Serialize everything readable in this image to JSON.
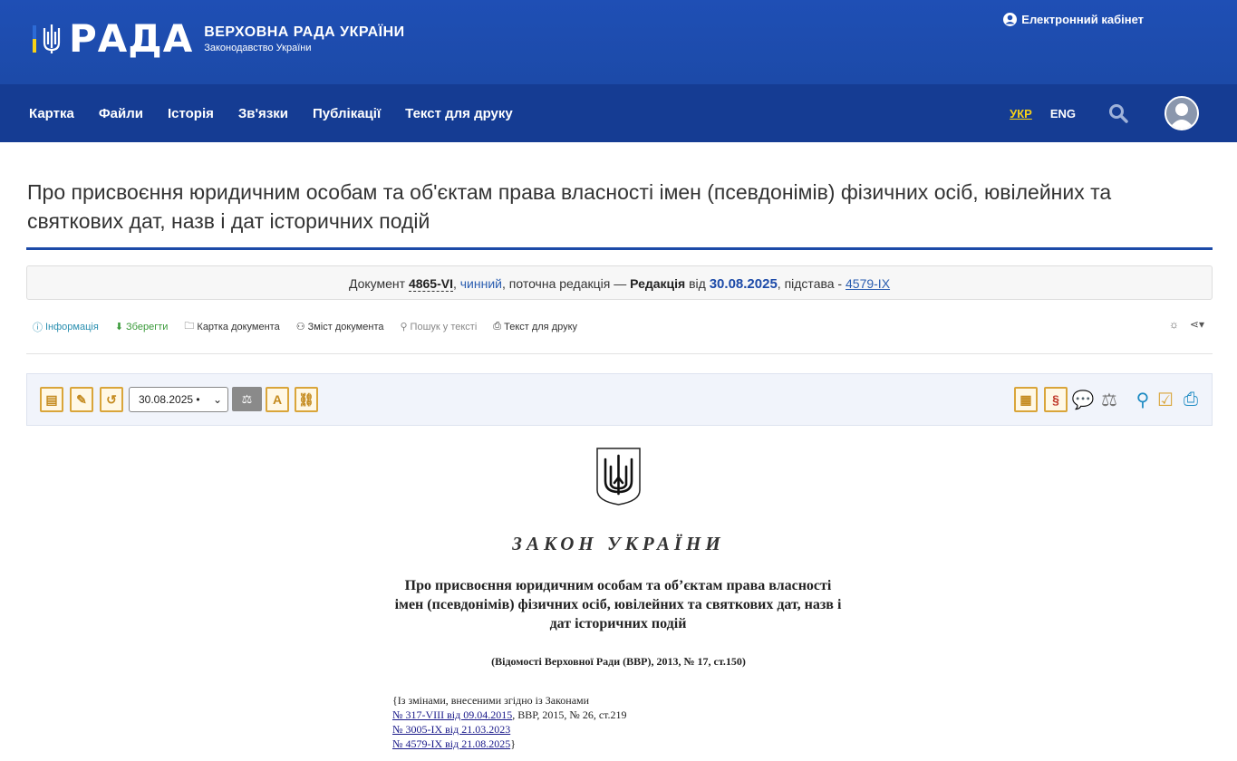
{
  "header": {
    "logo_text": "РАДА",
    "org_name": "ВЕРХОВНА РАДА УКРАЇНИ",
    "org_sub": "Законодавство України",
    "cabinet_label": "Електронний кабінет"
  },
  "nav": {
    "items": [
      {
        "label": "Картка"
      },
      {
        "label": "Файли"
      },
      {
        "label": "Історія"
      },
      {
        "label": "Зв'язки"
      },
      {
        "label": "Публікації"
      },
      {
        "label": "Текст для друку"
      }
    ],
    "lang_ukr": "УКР",
    "lang_eng": "ENG"
  },
  "page": {
    "title": "Про присвоєння юридичним особам та об'єктам права власності імен (псевдонімів) фізичних осіб, ювілейних та святкових дат, назв і дат історичних подій"
  },
  "status": {
    "doc_prefix": "Документ",
    "doc_number": "4865-VI",
    "state": "чинний",
    "mid_text": ", поточна редакція —",
    "edition_label": "Редакція",
    "from_word": "від",
    "edition_date": "30.08.2025",
    "basis_text": ", підстава -",
    "basis_link": "4579-IX"
  },
  "doc_links": {
    "info": "Інформація",
    "save": "Зберегти",
    "card": "Картка документа",
    "contents": "Зміст документа",
    "search": "Пошук у тексті",
    "print": "Текст для друку"
  },
  "toolbar": {
    "date_value": "30.08.2025 •"
  },
  "law": {
    "header": "ЗАКОН УКРАЇНИ",
    "title": "Про присвоєння юридичним особам та об’єктам права власності імен (псевдонімів) фізичних осіб, ювілейних та святкових дат, назв і дат історичних подій",
    "source": "(Відомості Верховної Ради (ВВР), 2013, № 17, ст.150)",
    "amend_intro": "{Із змінами, внесеними згідно із Законами",
    "amend_1_link": "№ 317-VIII від 09.04.2015",
    "amend_1_tail": ", ВВР, 2015, № 26, ст.219",
    "amend_2_link": "№ 3005-IX від 21.03.2023",
    "amend_3_link": "№ 4579-IX від 21.08.2025",
    "amend_close": "}"
  }
}
